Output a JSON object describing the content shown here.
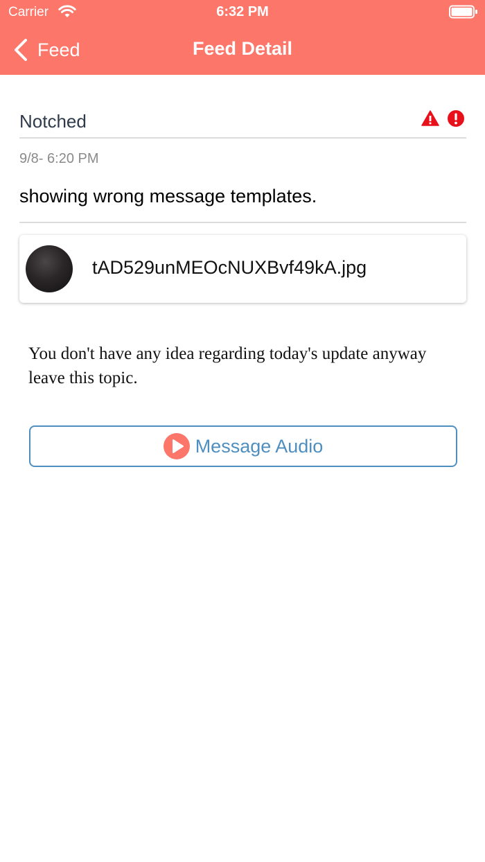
{
  "status_bar": {
    "carrier": "Carrier",
    "time": "6:32 PM"
  },
  "nav": {
    "back_label": "Feed",
    "title": "Feed Detail"
  },
  "feed": {
    "title": "Notched",
    "date": "9/8- 6:20 PM",
    "subject": "showing wrong message templates.",
    "attachment": {
      "filename": "tAD529unMEOcNUXBvf49kA.jpg"
    },
    "message": "You don't have any idea regarding today's update anyway leave this topic.",
    "audio_button": {
      "label": "Message Audio"
    }
  },
  "colors": {
    "header": "#fc766a",
    "accent": "#4f8fc0",
    "alert": "#e8101b"
  },
  "icons": {
    "back": "chevron-left-icon",
    "warning": "warning-triangle-icon",
    "alert": "exclamation-circle-icon",
    "play": "play-circle-icon"
  }
}
